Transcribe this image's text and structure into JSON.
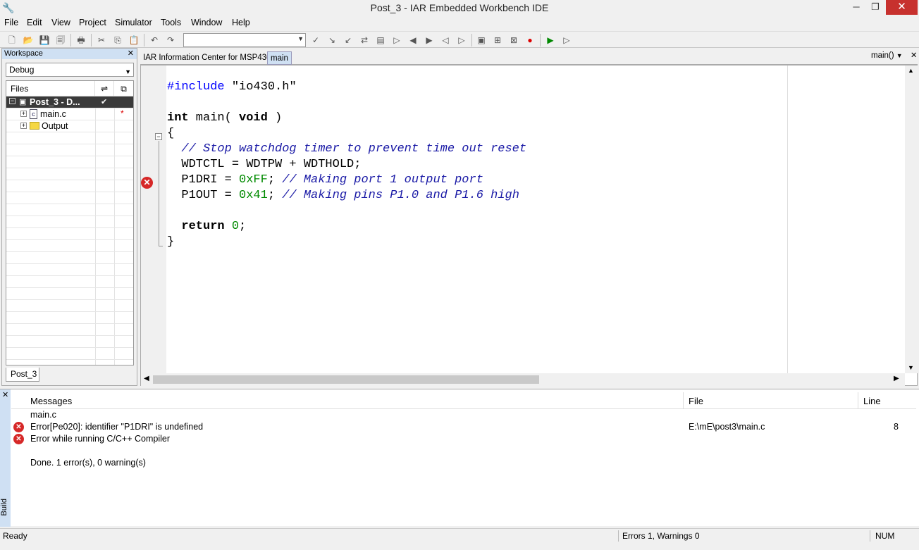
{
  "window": {
    "title": "Post_3 - IAR Embedded Workbench IDE",
    "min": "─",
    "max": "❐",
    "close": "✕"
  },
  "menu": [
    "File",
    "Edit",
    "View",
    "Project",
    "Simulator",
    "Tools",
    "Window",
    "Help"
  ],
  "toolbar": {
    "combo_value": ""
  },
  "workspace": {
    "title": "Workspace",
    "configuration": "Debug",
    "files_header": "Files",
    "tree": [
      {
        "label": "Post_3 - D...",
        "check": "✔"
      },
      {
        "label": "main.c",
        "mark": "*"
      },
      {
        "label": "Output"
      }
    ],
    "tab": "Post_3"
  },
  "editor": {
    "tabs": [
      "IAR Information Center for MSP430",
      "main"
    ],
    "active_tab": "main",
    "function_selector": "main()",
    "code": {
      "l1_pp": "#include",
      "l1_str": " \"io430.h\"",
      "l2_kw": "int",
      "l2_a": " main( ",
      "l2_kw2": "void",
      "l2_b": " )",
      "l3": "{",
      "l4_cm": "  // Stop watchdog timer to prevent time out reset",
      "l5": "  WDTCTL = WDTPW + WDTHOLD;",
      "l6_a": "  P1DRI = ",
      "l6_num": "0xFF",
      "l6_b": "; ",
      "l6_cm": "// Making port 1 output port",
      "l7_a": "  P1OUT = ",
      "l7_num": "0x41",
      "l7_b": "; ",
      "l7_cm": "// Making pins P1.0 and P1.6 high",
      "l9_kw": "  return",
      "l9_num": " 0",
      "l9_b": ";",
      "l10": "}"
    }
  },
  "messages": {
    "panel_label": "Build",
    "headers": {
      "messages": "Messages",
      "file": "File",
      "line": "Line"
    },
    "rows": [
      {
        "text": "main.c",
        "file": "",
        "line": ""
      },
      {
        "text": "Error[Pe020]: identifier \"P1DRI\" is undefined",
        "file": "E:\\mE\\post3\\main.c",
        "line": "8"
      },
      {
        "text": "Error while running C/C++ Compiler",
        "file": "",
        "line": ""
      },
      {
        "text": "Done. 1 error(s), 0 warning(s)",
        "file": "",
        "line": ""
      }
    ]
  },
  "status": {
    "left": "Ready",
    "errors": "Errors 1, Warnings 0",
    "num": "NUM"
  }
}
